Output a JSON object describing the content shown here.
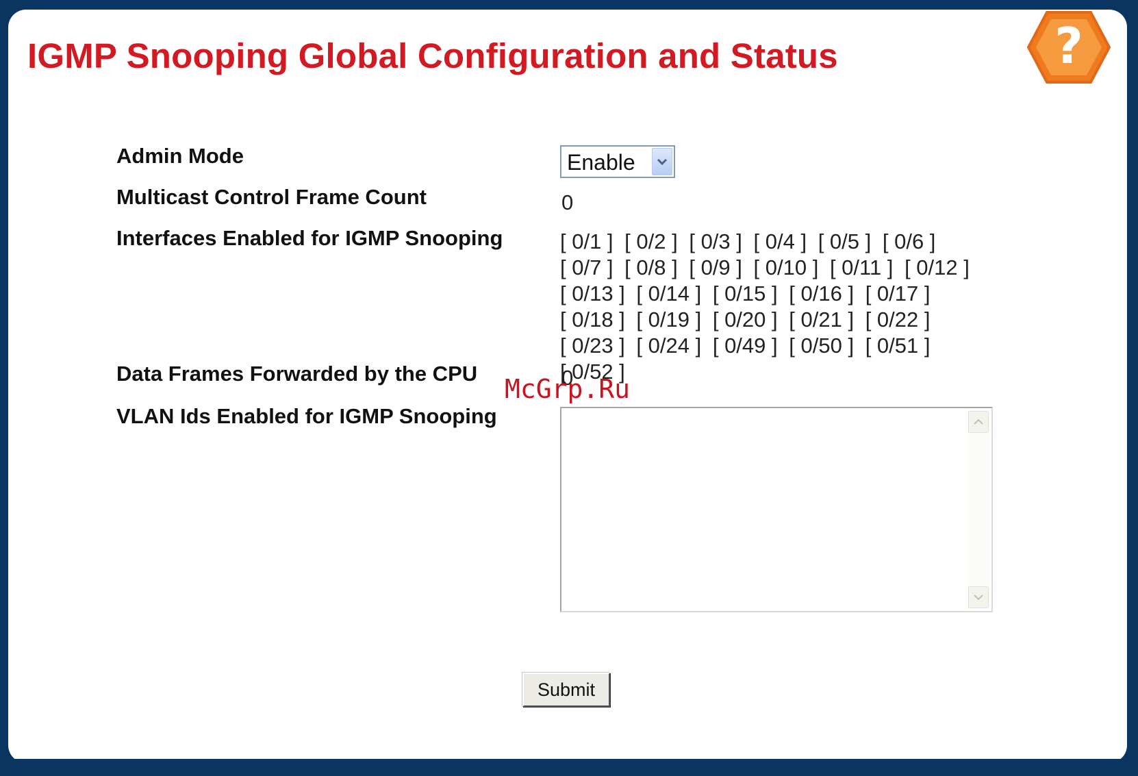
{
  "page": {
    "title": "IGMP Snooping Global Configuration and Status"
  },
  "help": {
    "icon": "help-question-icon",
    "glyph": "?"
  },
  "form": {
    "admin_mode": {
      "label": "Admin Mode",
      "selected": "Enable"
    },
    "multicast_control_frame_count": {
      "label": "Multicast Control Frame Count",
      "value": "0"
    },
    "interfaces_enabled": {
      "label": "Interfaces Enabled for IGMP Snooping",
      "items": [
        "[ 0/1 ]",
        "[ 0/2 ]",
        "[ 0/3 ]",
        "[ 0/4 ]",
        "[ 0/5 ]",
        "[ 0/6 ]",
        "[ 0/7 ]",
        "[ 0/8 ]",
        "[ 0/9 ]",
        "[ 0/10 ]",
        "[ 0/11 ]",
        "[ 0/12 ]",
        "[ 0/13 ]",
        "[ 0/14 ]",
        "[ 0/15 ]",
        "[ 0/16 ]",
        "[ 0/17 ]",
        "[ 0/18 ]",
        "[ 0/19 ]",
        "[ 0/20 ]",
        "[ 0/21 ]",
        "[ 0/22 ]",
        "[ 0/23 ]",
        "[ 0/24 ]",
        "[ 0/49 ]",
        "[ 0/50 ]",
        "[ 0/51 ]",
        "[ 0/52 ]"
      ]
    },
    "data_frames_forwarded": {
      "label": "Data Frames Forwarded by the CPU",
      "value": "0"
    },
    "vlan_ids_enabled": {
      "label": "VLAN Ids Enabled for IGMP Snooping",
      "value": ""
    }
  },
  "actions": {
    "submit_label": "Submit"
  },
  "watermark": {
    "text": "McGrp.Ru"
  },
  "colors": {
    "title": "#d21a23",
    "frame_border": "#0b3561",
    "help_badge": "#f07a1e"
  }
}
